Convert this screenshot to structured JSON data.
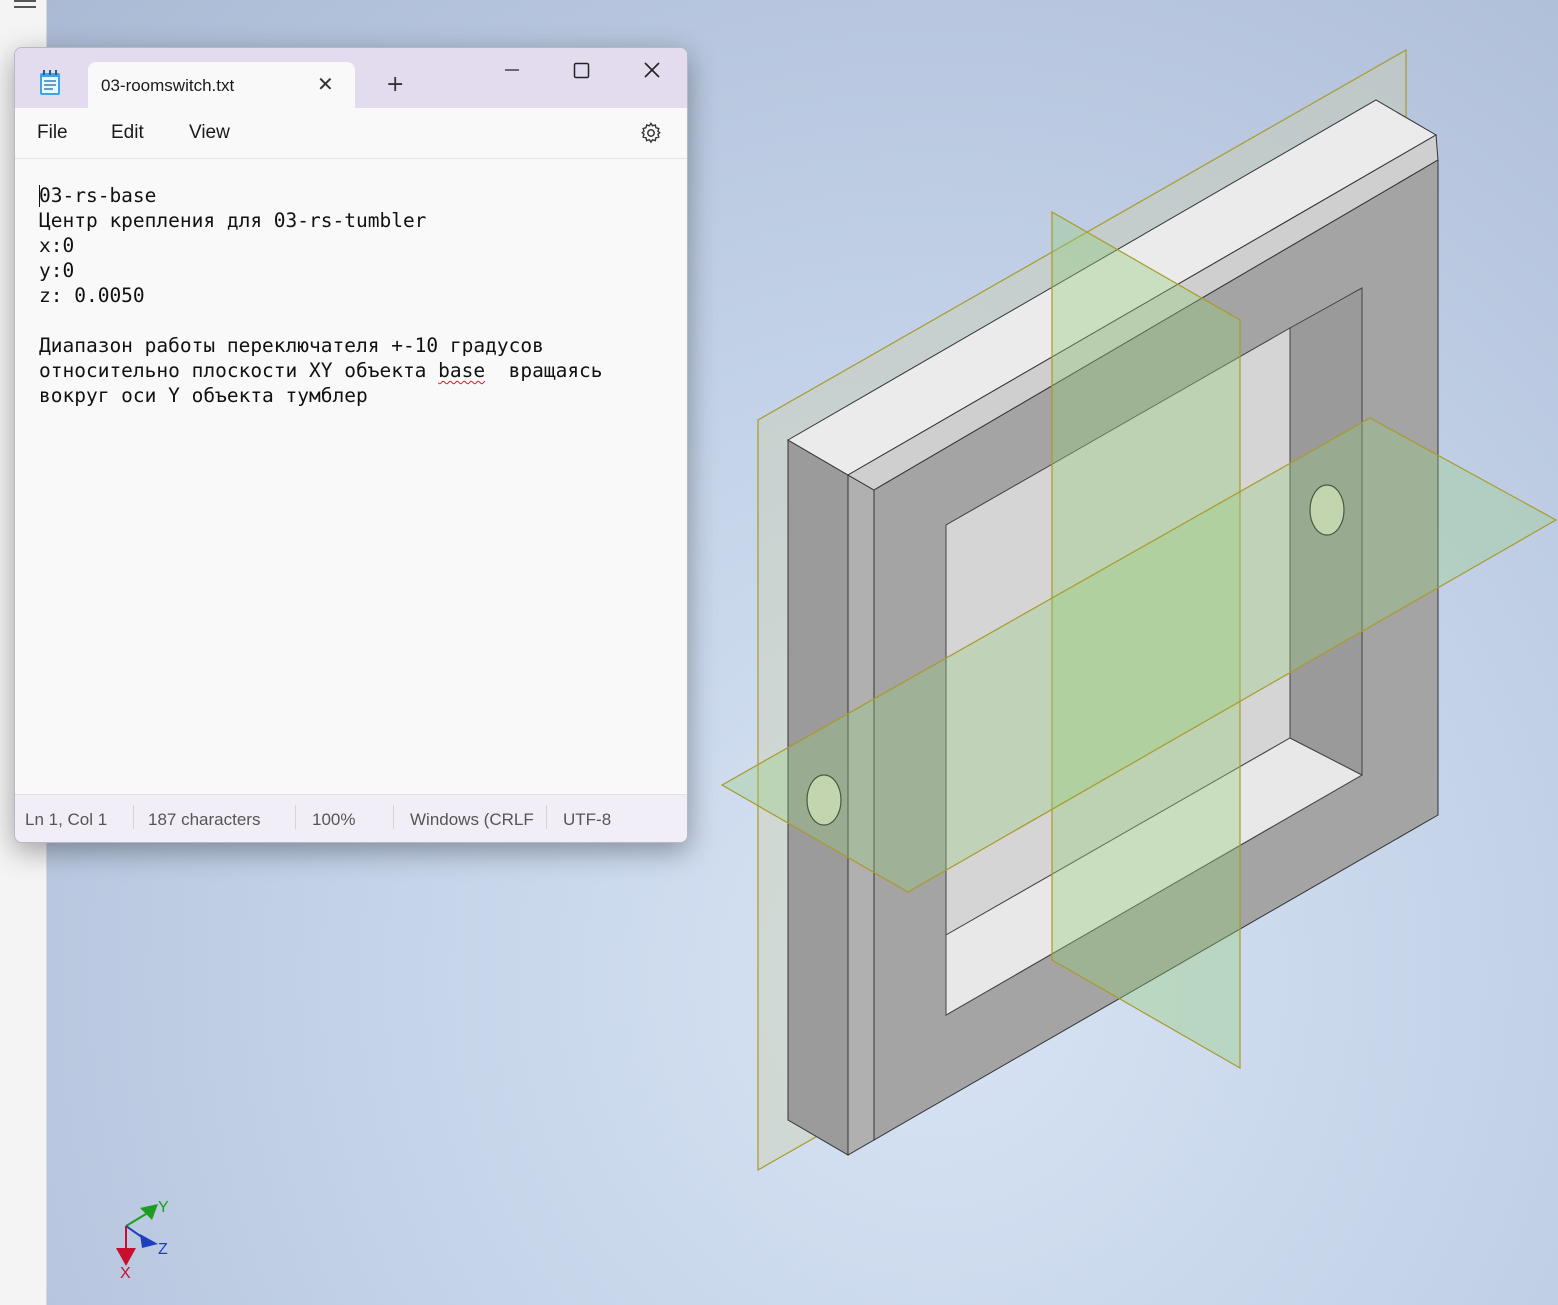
{
  "notepad": {
    "tab_title": "03-roomswitch.txt",
    "new_tab_label": "+",
    "menu": {
      "file": "File",
      "edit": "Edit",
      "view": "View"
    },
    "icons": {
      "app": "notepad-icon",
      "tab_close": "close-icon",
      "minimize": "minimize-icon",
      "maximize": "maximize-icon",
      "close": "close-icon",
      "settings": "gear-icon"
    },
    "content": {
      "line1": "03-rs-base",
      "line2": "Центр крепления для 03-rs-tumbler",
      "line3": "x:0",
      "line4": "y:0",
      "line5": "z: 0.0050",
      "line7": "Диапазон работы переключателя +-10 градусов",
      "line8_before": "относительно плоскости XY объекта ",
      "line8_misspelled": "base",
      "line8_after": "  вращаясь",
      "line9": "вокруг оси Y объекта тумблер"
    },
    "status": {
      "position": "Ln 1, Col 1",
      "characters": "187 characters",
      "zoom": "100%",
      "line_ending": "Windows (CRLF",
      "encoding": "UTF-8"
    }
  },
  "triad": {
    "x_label": "X",
    "y_label": "Y",
    "z_label": "Z",
    "colors": {
      "x": "#c8102e",
      "y": "#1f9d1f",
      "z": "#1f3fbf"
    }
  }
}
